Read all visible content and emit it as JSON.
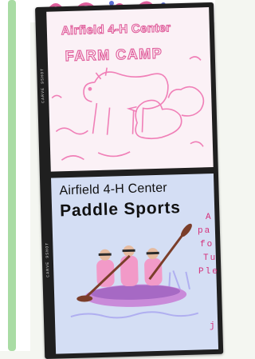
{
  "cards": [
    {
      "title_line1": "Airfield 4-H Center",
      "title_line2": "FARM CAMP",
      "edge_label": "CARVE 9SHOT",
      "edge_number": "2"
    },
    {
      "title_line1": "Airfield 4-H Center",
      "title_line2": "Paddle Sports",
      "edge_label": "CARVE 9SHOT",
      "edge_number": "3"
    }
  ],
  "side_text_fragments": [
    "A",
    "pa",
    "fo",
    "Tu",
    "Ple",
    "j"
  ],
  "colors": {
    "accent_pink": "#e0609d",
    "side_text": "#d4307a",
    "film": "#1f1f1f",
    "green_stripe": "#a9dca4",
    "farm_bg": "#fbf1f6",
    "paddle_bg": "#d4def4"
  }
}
